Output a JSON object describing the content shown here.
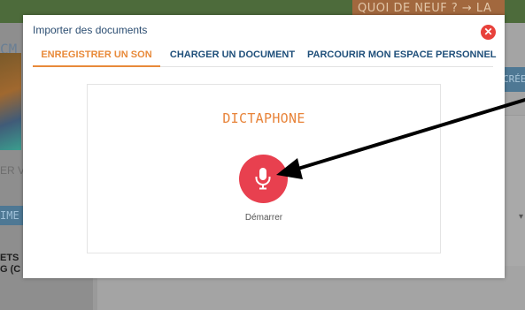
{
  "background": {
    "header_banner_text": "QUOI DE NEUF ? → LA CLASSE",
    "left_heading_fragment": "CM",
    "left_link_fragment": "ER V",
    "left_tab_fragment": "IME",
    "left_text_fragment_1": "ETS",
    "left_text_fragment_2": "G (C",
    "right_button_fragment": "CRÉE"
  },
  "modal": {
    "title": "Importer des documents",
    "close_icon": "close-icon",
    "tabs": [
      {
        "label": "ENREGISTRER UN SON",
        "active": true
      },
      {
        "label": "CHARGER UN DOCUMENT",
        "active": false
      },
      {
        "label": "PARCOURIR MON ESPACE PERSONNEL",
        "active": false
      }
    ],
    "dictaphone": {
      "title": "DICTAPHONE",
      "mic_icon": "microphone-icon",
      "start_label": "Démarrer"
    }
  },
  "colors": {
    "accent_orange": "#e88a3a",
    "tab_blue": "#1f4f7a",
    "record_red": "#e8404f",
    "close_red": "#e8413b"
  }
}
